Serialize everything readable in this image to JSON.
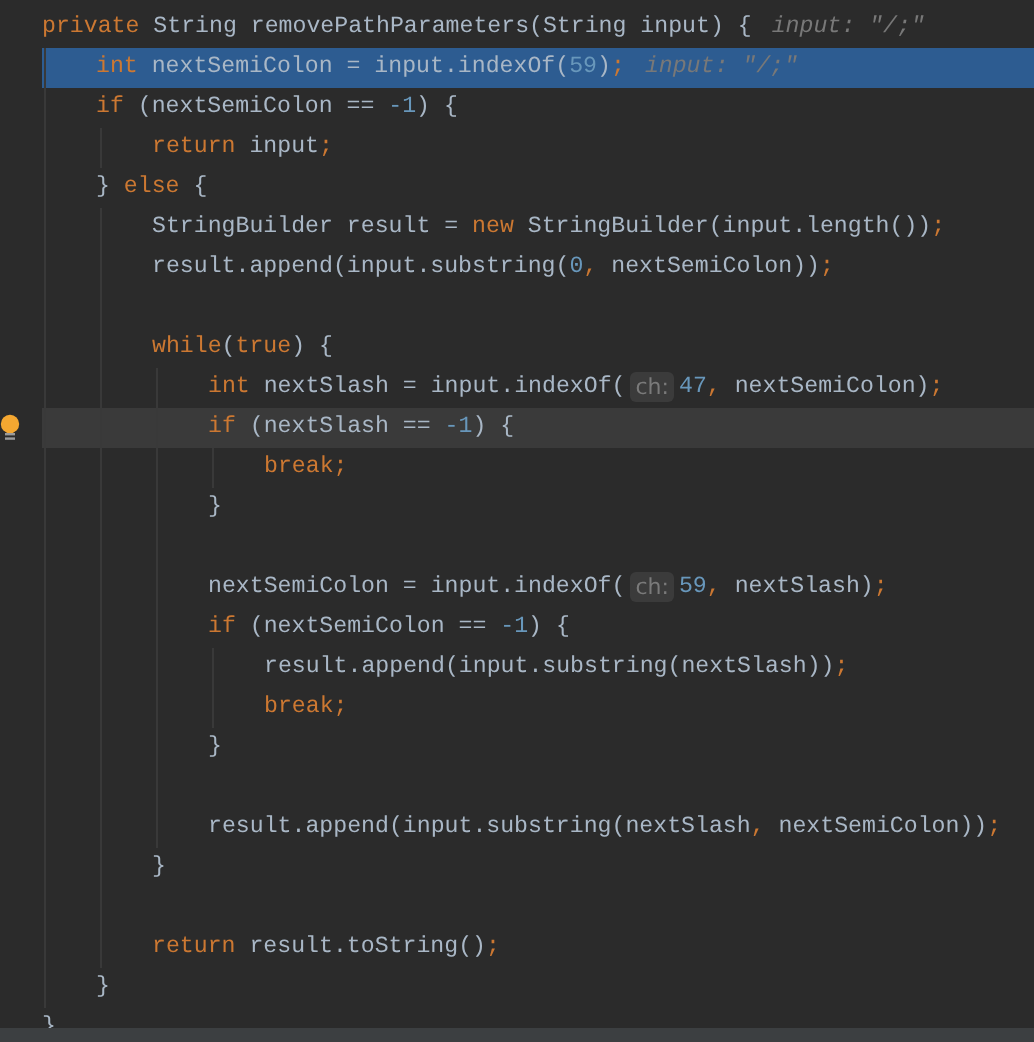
{
  "editor": {
    "lines": [
      {
        "execution_point": false,
        "current_line": false,
        "bulb": false,
        "tokens": [
          {
            "kind": "keyword",
            "text": "private "
          },
          {
            "kind": "plain",
            "text": "String removePathParameters(String input) {"
          },
          {
            "kind": "hint",
            "text": "input: \"/;\""
          }
        ],
        "children": [
          {
            "execution_point": true,
            "bulb": false,
            "tokens": [
              {
                "kind": "keyword",
                "text": "int "
              },
              {
                "kind": "plain",
                "text": "nextSemiColon = input.indexOf("
              },
              {
                "kind": "number",
                "text": "59"
              },
              {
                "kind": "plain",
                "text": ")"
              },
              {
                "kind": "keyword",
                "text": ";"
              },
              {
                "kind": "hint",
                "text": "input: \"/;\""
              }
            ]
          },
          {
            "execution_point": false,
            "current_line": false,
            "bulb": false,
            "tokens": [
              {
                "kind": "keyword",
                "text": "if "
              },
              {
                "kind": "plain",
                "text": "(nextSemiColon == "
              },
              {
                "kind": "number",
                "text": "-1"
              },
              {
                "kind": "plain",
                "text": ") {"
              }
            ],
            "children": [
              {
                "execution_point": false,
                "current_line": false,
                "bulb": false,
                "tokens": [
                  {
                    "kind": "keyword",
                    "text": "return "
                  },
                  {
                    "kind": "plain",
                    "text": "input"
                  },
                  {
                    "kind": "keyword",
                    "text": ";"
                  }
                ]
              }
            ]
          },
          {
            "execution_point": false,
            "current_line": false,
            "bulb": false,
            "tokens": [
              {
                "kind": "plain",
                "text": "} "
              },
              {
                "kind": "keyword",
                "text": "else "
              },
              {
                "kind": "plain",
                "text": "{"
              }
            ],
            "children": [
              {
                "execution_point": false,
                "current_line": false,
                "bulb": false,
                "tokens": [
                  {
                    "kind": "plain",
                    "text": "StringBuilder result = "
                  },
                  {
                    "kind": "keyword",
                    "text": "new "
                  },
                  {
                    "kind": "plain",
                    "text": "StringBuilder(input.length())"
                  },
                  {
                    "kind": "keyword",
                    "text": ";"
                  }
                ]
              },
              {
                "execution_point": false,
                "current_line": false,
                "bulb": false,
                "tokens": [
                  {
                    "kind": "plain",
                    "text": "result.append(input.substring("
                  },
                  {
                    "kind": "number",
                    "text": "0"
                  },
                  {
                    "kind": "keyword",
                    "text": ", "
                  },
                  {
                    "kind": "plain",
                    "text": "nextSemiColon))"
                  },
                  {
                    "kind": "keyword",
                    "text": ";"
                  }
                ]
              },
              {
                "execution_point": false,
                "current_line": false,
                "bulb": false
              },
              {
                "execution_point": false,
                "current_line": false,
                "bulb": false,
                "tokens": [
                  {
                    "kind": "keyword",
                    "text": "while"
                  },
                  {
                    "kind": "plain",
                    "text": "("
                  },
                  {
                    "kind": "keyword",
                    "text": "true"
                  },
                  {
                    "kind": "plain",
                    "text": ") {"
                  }
                ],
                "children": [
                  {
                    "execution_point": false,
                    "current_line": false,
                    "bulb": false,
                    "tokens": [
                      {
                        "kind": "keyword",
                        "text": "int "
                      },
                      {
                        "kind": "plain",
                        "text": "nextSlash = input.indexOf("
                      },
                      {
                        "kind": "param",
                        "text": "ch:"
                      },
                      {
                        "kind": "number",
                        "text": "47"
                      },
                      {
                        "kind": "keyword",
                        "text": ", "
                      },
                      {
                        "kind": "plain",
                        "text": "nextSemiColon)"
                      },
                      {
                        "kind": "keyword",
                        "text": ";"
                      }
                    ]
                  },
                  {
                    "execution_point": false,
                    "current_line": true,
                    "bulb": true,
                    "tokens": [
                      {
                        "kind": "keyword",
                        "text": "if "
                      },
                      {
                        "kind": "plain",
                        "text": "(nextSlash == "
                      },
                      {
                        "kind": "number",
                        "text": "-1"
                      },
                      {
                        "kind": "plain",
                        "text": ") {"
                      }
                    ],
                    "children": [
                      {
                        "execution_point": false,
                        "current_line": false,
                        "bulb": false,
                        "tokens": [
                          {
                            "kind": "keyword",
                            "text": "break;"
                          }
                        ]
                      }
                    ]
                  },
                  {
                    "execution_point": false,
                    "current_line": false,
                    "bulb": false,
                    "tokens": [
                      {
                        "kind": "plain",
                        "text": "}"
                      }
                    ]
                  },
                  {
                    "execution_point": false,
                    "current_line": false,
                    "bulb": false
                  },
                  {
                    "execution_point": false,
                    "current_line": false,
                    "bulb": false,
                    "tokens": [
                      {
                        "kind": "plain",
                        "text": "nextSemiColon = input.indexOf("
                      },
                      {
                        "kind": "param",
                        "text": "ch:"
                      },
                      {
                        "kind": "number",
                        "text": "59"
                      },
                      {
                        "kind": "keyword",
                        "text": ", "
                      },
                      {
                        "kind": "plain",
                        "text": "nextSlash)"
                      },
                      {
                        "kind": "keyword",
                        "text": ";"
                      }
                    ]
                  },
                  {
                    "execution_point": false,
                    "current_line": false,
                    "bulb": false,
                    "tokens": [
                      {
                        "kind": "keyword",
                        "text": "if "
                      },
                      {
                        "kind": "plain",
                        "text": "(nextSemiColon == "
                      },
                      {
                        "kind": "number",
                        "text": "-1"
                      },
                      {
                        "kind": "plain",
                        "text": ") {"
                      }
                    ],
                    "children": [
                      {
                        "execution_point": false,
                        "current_line": false,
                        "bulb": false,
                        "tokens": [
                          {
                            "kind": "plain",
                            "text": "result.append(input.substring(nextSlash))"
                          },
                          {
                            "kind": "keyword",
                            "text": ";"
                          }
                        ]
                      },
                      {
                        "execution_point": false,
                        "current_line": false,
                        "bulb": false,
                        "tokens": [
                          {
                            "kind": "keyword",
                            "text": "break;"
                          }
                        ]
                      }
                    ]
                  },
                  {
                    "execution_point": false,
                    "current_line": false,
                    "bulb": false,
                    "tokens": [
                      {
                        "kind": "plain",
                        "text": "}"
                      }
                    ]
                  },
                  {
                    "execution_point": false,
                    "current_line": false,
                    "bulb": false
                  },
                  {
                    "execution_point": false,
                    "current_line": false,
                    "bulb": false,
                    "tokens": [
                      {
                        "kind": "plain",
                        "text": "result.append(input.substring(nextSlash"
                      },
                      {
                        "kind": "keyword",
                        "text": ", "
                      },
                      {
                        "kind": "plain",
                        "text": "nextSemiColon))"
                      },
                      {
                        "kind": "keyword",
                        "text": ";"
                      }
                    ]
                  }
                ]
              },
              {
                "execution_point": false,
                "current_line": false,
                "bulb": false,
                "tokens": [
                  {
                    "kind": "plain",
                    "text": "}"
                  }
                ]
              },
              {
                "execution_point": false,
                "current_line": false,
                "bulb": false
              },
              {
                "execution_point": false,
                "current_line": false,
                "bulb": false,
                "tokens": [
                  {
                    "kind": "keyword",
                    "text": "return "
                  },
                  {
                    "kind": "plain",
                    "text": "result.toString()"
                  },
                  {
                    "kind": "keyword",
                    "text": ";"
                  }
                ]
              }
            ]
          },
          {
            "execution_point": false,
            "current_line": false,
            "bulb": false,
            "tokens": [
              {
                "kind": "plain",
                "text": "}"
              }
            ]
          }
        ]
      },
      {
        "execution_point": false,
        "current_line": false,
        "bulb": false,
        "tokens": [
          {
            "kind": "plain",
            "text": "}"
          }
        ]
      }
    ]
  }
}
